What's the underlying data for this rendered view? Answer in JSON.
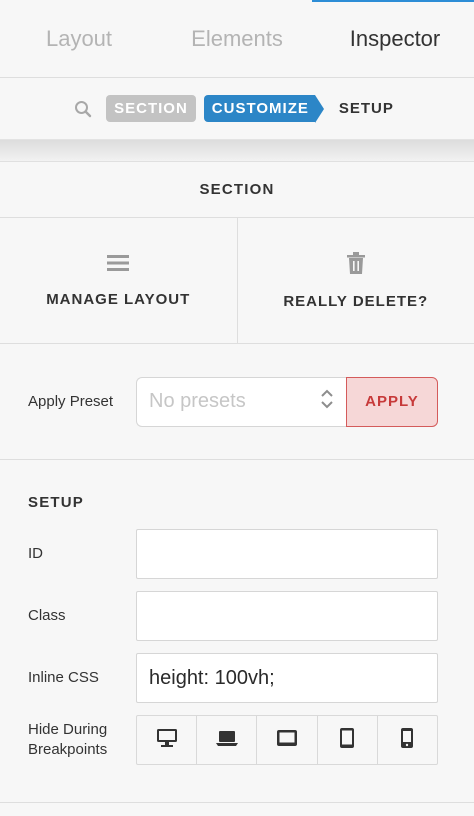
{
  "tabs": [
    {
      "label": "Layout",
      "active": false
    },
    {
      "label": "Elements",
      "active": false
    },
    {
      "label": "Inspector",
      "active": true
    }
  ],
  "breadcrumb": {
    "search_icon": "search-icon",
    "items": [
      "SECTION",
      "CUSTOMIZE",
      "SETUP"
    ]
  },
  "panel": {
    "title": "SECTION",
    "actions": [
      {
        "label": "MANAGE LAYOUT",
        "icon": "menu-icon"
      },
      {
        "label": "REALLY DELETE?",
        "icon": "trash-icon"
      }
    ]
  },
  "preset": {
    "label": "Apply Preset",
    "placeholder": "No presets",
    "apply_label": "APPLY"
  },
  "setup": {
    "title": "SETUP",
    "id_label": "ID",
    "id_value": "",
    "class_label": "Class",
    "class_value": "",
    "inline_css_label": "Inline CSS",
    "inline_css_value": "height: 100vh;",
    "breakpoints_label": "Hide During Breakpoints",
    "breakpoints": [
      "desktop-icon",
      "laptop-icon",
      "tablet-landscape-icon",
      "tablet-portrait-icon",
      "phone-icon"
    ]
  },
  "colors": {
    "accent_blue": "#2c86c7",
    "crumb_grey": "#c3c3c3",
    "apply_red": "#c73a3a",
    "apply_bg": "#f6d7d7"
  }
}
